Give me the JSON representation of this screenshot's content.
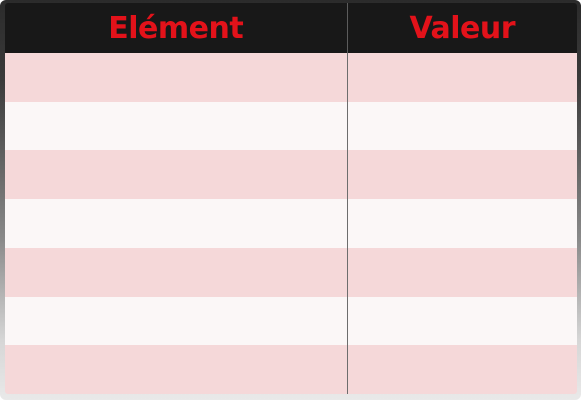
{
  "table": {
    "columns": [
      "Elément",
      "Valeur"
    ],
    "rows": [
      [
        "",
        ""
      ],
      [
        "",
        ""
      ],
      [
        "",
        ""
      ],
      [
        "",
        ""
      ],
      [
        "",
        ""
      ],
      [
        "",
        ""
      ],
      [
        "",
        ""
      ]
    ]
  },
  "colors": {
    "header_background": "#181818",
    "header_text": "#e3121a",
    "row_odd": "#f5d8d9",
    "row_even": "#fbf7f7",
    "frame_top": "#2b2b2b",
    "frame_bottom": "#e9e9e9"
  }
}
